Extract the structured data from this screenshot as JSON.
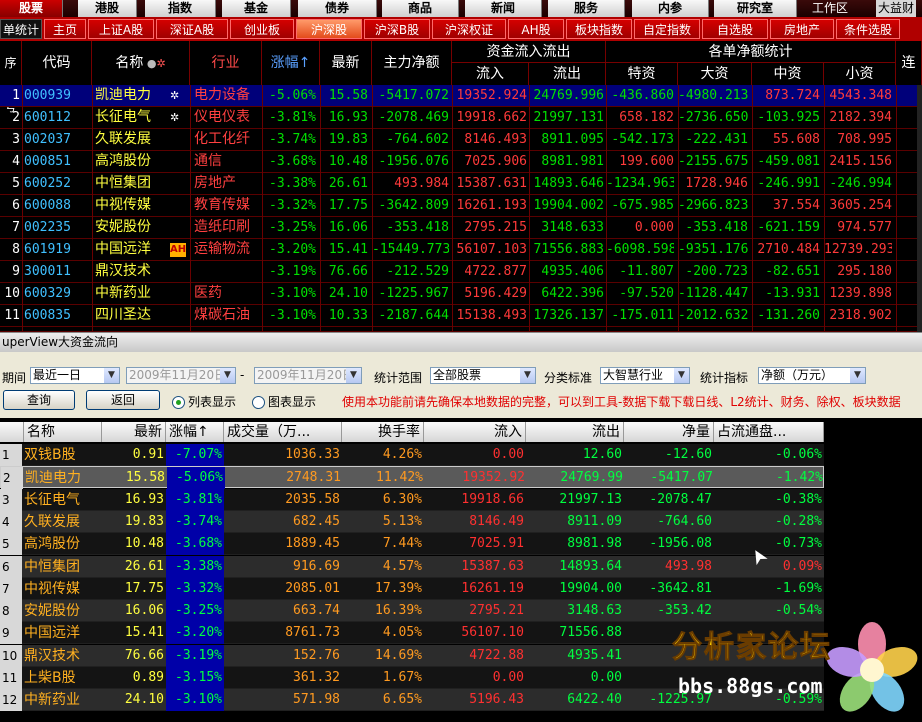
{
  "top_menu": {
    "items": [
      "股票",
      "港股",
      "指数",
      "基金",
      "债券",
      "商品",
      "新闻",
      "服务",
      "内参",
      "研究室"
    ],
    "right_text": "工作区",
    "right_text2": "大益财"
  },
  "tabs": [
    "单统计",
    "主页",
    "上证A股",
    "深证A股",
    "创业板",
    "沪深股",
    "沪深B股",
    "沪深权证",
    "AH股",
    "板块指数",
    "自定指数",
    "自选股",
    "房地产",
    "条件选股"
  ],
  "active_tab": "沪深股",
  "upper": {
    "headers": {
      "seq": "序号",
      "code": "代码",
      "name": "名称",
      "industry": "行业",
      "change": "涨幅↑",
      "latest": "最新",
      "main_net": "主力净额",
      "fund_flow_group": "资金流入流出",
      "inflow": "流入",
      "outflow": "流出",
      "order_group": "各单净额统计",
      "special": "特资",
      "large": "大资",
      "medium": "中资",
      "small": "小资",
      "extra": "连续"
    },
    "rows": [
      {
        "seq": "1",
        "code": "000939",
        "name": "凯迪电力",
        "icon": "✲",
        "industry": "电力设备",
        "change": "-5.06%",
        "latest": "15.58",
        "main": "-5417.072",
        "in": "19352.924",
        "out": "24769.996",
        "special": "-436.860",
        "large": "-4980.213",
        "medium": "873.724",
        "small": "4543.348"
      },
      {
        "seq": "2",
        "code": "600112",
        "name": "长征电气",
        "icon": "✲",
        "industry": "仪电仪表",
        "change": "-3.81%",
        "latest": "16.93",
        "main": "-2078.469",
        "in": "19918.662",
        "out": "21997.131",
        "special": "658.182",
        "large": "-2736.650",
        "medium": "-103.925",
        "small": "2182.394"
      },
      {
        "seq": "3",
        "code": "002037",
        "name": "久联发展",
        "icon": "",
        "industry": "化工化纤",
        "change": "-3.74%",
        "latest": "19.83",
        "main": "-764.602",
        "in": "8146.493",
        "out": "8911.095",
        "special": "-542.173",
        "large": "-222.431",
        "medium": "55.608",
        "small": "708.995"
      },
      {
        "seq": "4",
        "code": "000851",
        "name": "高鸿股份",
        "icon": "",
        "industry": "通信",
        "change": "-3.68%",
        "latest": "10.48",
        "main": "-1956.076",
        "in": "7025.906",
        "out": "8981.981",
        "special": "199.600",
        "large": "-2155.675",
        "medium": "-459.081",
        "small": "2415.156"
      },
      {
        "seq": "5",
        "code": "600252",
        "name": "中恒集团",
        "icon": "",
        "industry": "房地产",
        "change": "-3.38%",
        "latest": "26.61",
        "main": "493.984",
        "in": "15387.631",
        "out": "14893.646",
        "special": "-1234.963",
        "large": "1728.946",
        "medium": "-246.991",
        "small": "-246.994"
      },
      {
        "seq": "6",
        "code": "600088",
        "name": "中视传媒",
        "icon": "",
        "industry": "教育传媒",
        "change": "-3.32%",
        "latest": "17.75",
        "main": "-3642.809",
        "in": "16261.193",
        "out": "19904.002",
        "special": "-675.985",
        "large": "-2966.823",
        "medium": "37.554",
        "small": "3605.254"
      },
      {
        "seq": "7",
        "code": "002235",
        "name": "安妮股份",
        "icon": "",
        "industry": "造纸印刷",
        "change": "-3.25%",
        "latest": "16.06",
        "main": "-353.418",
        "in": "2795.215",
        "out": "3148.633",
        "special": "0.000",
        "large": "-353.418",
        "medium": "-621.159",
        "small": "974.577"
      },
      {
        "seq": "8",
        "code": "601919",
        "name": "中国远洋",
        "icon": "AH",
        "industry": "运输物流",
        "change": "-3.20%",
        "latest": "15.41",
        "main": "-15449.773",
        "in": "56107.103",
        "out": "71556.883",
        "special": "-6098.598",
        "large": "-9351.176",
        "medium": "2710.484",
        "small": "12739.293"
      },
      {
        "seq": "9",
        "code": "300011",
        "name": "鼎汉技术",
        "icon": "",
        "industry": "",
        "change": "-3.19%",
        "latest": "76.66",
        "main": "-212.529",
        "in": "4722.877",
        "out": "4935.406",
        "special": "-11.807",
        "large": "-200.723",
        "medium": "-82.651",
        "small": "295.180"
      },
      {
        "seq": "10",
        "code": "600329",
        "name": "中新药业",
        "icon": "",
        "industry": "医药",
        "change": "-3.10%",
        "latest": "24.10",
        "main": "-1225.967",
        "in": "5196.429",
        "out": "6422.396",
        "special": "-97.520",
        "large": "-1128.447",
        "medium": "-13.931",
        "small": "1239.898"
      },
      {
        "seq": "11",
        "code": "600835",
        "name": "四川圣达",
        "icon": "",
        "industry": "煤碳石油",
        "change": "-3.10%",
        "latest": "10.33",
        "main": "-2187.644",
        "in": "15138.493",
        "out": "17326.137",
        "special": "-175.011",
        "large": "-2012.632",
        "medium": "-131.260",
        "small": "2318.902"
      }
    ]
  },
  "panel_title": "uperView大资金流向",
  "controls": {
    "period_label": "期间",
    "period_value": "最近一日",
    "date_from": "2009年11月20日",
    "dash": "-",
    "date_to": "2009年11月20日",
    "scope_label": "统计范围",
    "scope_value": "全部股票",
    "class_label": "分类标准",
    "class_value": "大智慧行业",
    "metric_label": "统计指标",
    "metric_value": "净额（万元）",
    "query_button": "查询",
    "back_button": "返回",
    "radio_list": "列表显示",
    "radio_chart": "图表显示",
    "notice": "使用本功能前请先确保本地数据的完整，可以到工具-数据下载下载日线、L2统计、财务、除权、板块数据"
  },
  "lower": {
    "headers": [
      "名称",
      "最新",
      "涨幅↑",
      "成交量（万...",
      "换手率",
      "流入",
      "流出",
      "净量",
      "占流通盘..."
    ],
    "rows": [
      {
        "n": "1",
        "name": "双钱B股",
        "latest": "0.91",
        "change": "-7.07%",
        "vol": "1036.33",
        "turn": "4.26%",
        "in": "0.00",
        "out": "12.60",
        "net": "-12.60",
        "pct": "-0.06%"
      },
      {
        "n": "2",
        "name": "凯迪电力",
        "latest": "15.58",
        "change": "-5.06%",
        "vol": "2748.31",
        "turn": "11.42%",
        "in": "19352.92",
        "out": "24769.99",
        "net": "-5417.07",
        "pct": "-1.42%"
      },
      {
        "n": "3",
        "name": "长征电气",
        "latest": "16.93",
        "change": "-3.81%",
        "vol": "2035.58",
        "turn": "6.30%",
        "in": "19918.66",
        "out": "21997.13",
        "net": "-2078.47",
        "pct": "-0.38%"
      },
      {
        "n": "4",
        "name": "久联发展",
        "latest": "19.83",
        "change": "-3.74%",
        "vol": "682.45",
        "turn": "5.13%",
        "in": "8146.49",
        "out": "8911.09",
        "net": "-764.60",
        "pct": "-0.28%"
      },
      {
        "n": "5",
        "name": "高鸿股份",
        "latest": "10.48",
        "change": "-3.68%",
        "vol": "1889.45",
        "turn": "7.44%",
        "in": "7025.91",
        "out": "8981.98",
        "net": "-1956.08",
        "pct": "-0.73%"
      },
      {
        "n": "6",
        "name": "中恒集团",
        "latest": "26.61",
        "change": "-3.38%",
        "vol": "916.69",
        "turn": "4.57%",
        "in": "15387.63",
        "out": "14893.64",
        "net": "493.98",
        "pct": "0.09%"
      },
      {
        "n": "7",
        "name": "中视传媒",
        "latest": "17.75",
        "change": "-3.32%",
        "vol": "2085.01",
        "turn": "17.39%",
        "in": "16261.19",
        "out": "19904.00",
        "net": "-3642.81",
        "pct": "-1.69%"
      },
      {
        "n": "8",
        "name": "安妮股份",
        "latest": "16.06",
        "change": "-3.25%",
        "vol": "663.74",
        "turn": "16.39%",
        "in": "2795.21",
        "out": "3148.63",
        "net": "-353.42",
        "pct": "-0.54%"
      },
      {
        "n": "9",
        "name": "中国远洋",
        "latest": "15.41",
        "change": "-3.20%",
        "vol": "8761.73",
        "turn": "4.05%",
        "in": "56107.10",
        "out": "71556.88",
        "net": "",
        "pct": ""
      },
      {
        "n": "10",
        "name": "鼎汉技术",
        "latest": "76.66",
        "change": "-3.19%",
        "vol": "152.76",
        "turn": "14.69%",
        "in": "4722.88",
        "out": "4935.41",
        "net": "",
        "pct": ""
      },
      {
        "n": "11",
        "name": "上柴B股",
        "latest": "0.89",
        "change": "-3.15%",
        "vol": "361.32",
        "turn": "1.67%",
        "in": "0.00",
        "out": "0.00",
        "net": "",
        "pct": ""
      },
      {
        "n": "12",
        "name": "中新药业",
        "latest": "24.10",
        "change": "-3.10%",
        "vol": "571.98",
        "turn": "6.65%",
        "in": "5196.43",
        "out": "6422.40",
        "net": "-1225.97",
        "pct": "-0.59%"
      }
    ]
  },
  "watermark": {
    "title": "分析家论坛",
    "url": "bbs.88gs.com"
  },
  "colors": {
    "negative": "#00e000",
    "positive": "#ff3a3a",
    "name_yellow": "#ffff40",
    "code_cyan": "#40c0ff",
    "industry_red": "#ff4040"
  }
}
